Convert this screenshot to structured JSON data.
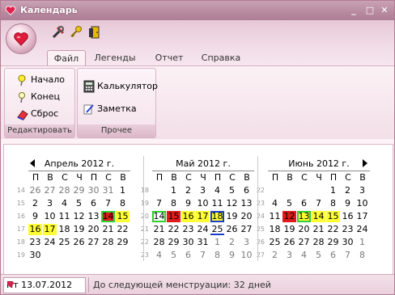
{
  "window": {
    "title": "Календарь",
    "min": "_",
    "max": "□",
    "close": "✕"
  },
  "tabs": [
    "Файл",
    "Легенды",
    "Отчет",
    "Справка"
  ],
  "ribbon": {
    "group1": {
      "title": "Редактировать",
      "buttons": [
        "Начало",
        "Конец",
        "Сброс"
      ]
    },
    "group2": {
      "title": "Прочее",
      "buttons": [
        "Калькулятор",
        "Заметка"
      ]
    }
  },
  "calendar": {
    "weekdays": [
      "П",
      "В",
      "С",
      "Ч",
      "П",
      "С",
      "В"
    ],
    "months": [
      {
        "title": "Апрель 2012 г.",
        "weeks": [
          "14",
          "15",
          "16",
          "17",
          "18",
          "19"
        ],
        "rows": [
          [
            "26",
            "27",
            "28",
            "29",
            "30",
            "31",
            "1"
          ],
          [
            "2",
            "3",
            "4",
            "5",
            "6",
            "7",
            "8"
          ],
          [
            "9",
            "10",
            "11",
            "12",
            "13",
            "14",
            "15"
          ],
          [
            "16",
            "17",
            "18",
            "19",
            "20",
            "21",
            "22"
          ],
          [
            "23",
            "24",
            "25",
            "26",
            "27",
            "28",
            "29"
          ],
          [
            "30",
            "",
            "",
            "",
            "",
            "",
            ""
          ]
        ]
      },
      {
        "title": "Май 2012 г.",
        "weeks": [
          "18",
          "19",
          "20",
          "21",
          "22",
          "23"
        ],
        "rows": [
          [
            "",
            "1",
            "2",
            "3",
            "4",
            "5",
            "6"
          ],
          [
            "7",
            "8",
            "9",
            "10",
            "11",
            "12",
            "13"
          ],
          [
            "14",
            "15",
            "16",
            "17",
            "18",
            "19",
            "20"
          ],
          [
            "21",
            "22",
            "23",
            "24",
            "25",
            "26",
            "27"
          ],
          [
            "28",
            "29",
            "30",
            "31",
            "1",
            "2",
            "3"
          ],
          [
            "4",
            "5",
            "6",
            "7",
            "8",
            "9",
            "10"
          ]
        ]
      },
      {
        "title": "Июнь 2012 г.",
        "weeks": [
          "22",
          "23",
          "24",
          "25",
          "26",
          "27"
        ],
        "rows": [
          [
            "",
            "",
            "",
            "",
            "1",
            "2",
            "3"
          ],
          [
            "4",
            "5",
            "6",
            "7",
            "8",
            "9",
            "10"
          ],
          [
            "11",
            "12",
            "13",
            "14",
            "15",
            "16",
            "17"
          ],
          [
            "18",
            "19",
            "20",
            "21",
            "22",
            "23",
            "24"
          ],
          [
            "25",
            "26",
            "27",
            "28",
            "29",
            "30",
            "1"
          ],
          [
            "2",
            "3",
            "4",
            "5",
            "6",
            "7",
            "8"
          ]
        ]
      }
    ],
    "colors": {
      "red": "#e01b1b",
      "yellow": "#ffff33",
      "green_border": "#33cc33",
      "blue_border": "#1c3cc8"
    }
  },
  "status": {
    "date": "Пт 13.07.2012",
    "message": "До следующей менструации: 32 дней"
  }
}
